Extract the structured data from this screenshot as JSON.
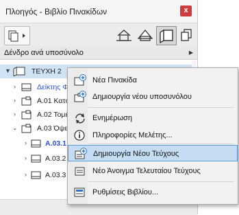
{
  "window": {
    "title": "Πλοηγός - Βιβλίο Πινακίδων",
    "close_label": "x"
  },
  "toolbar": {
    "buttons": [
      {
        "name": "project-map",
        "icon": "house-outline-icon"
      },
      {
        "name": "view-map",
        "icon": "house-plan-icon"
      },
      {
        "name": "layout-book",
        "icon": "layout-book-icon",
        "active": true
      },
      {
        "name": "publisher",
        "icon": "stacked-sheets-icon"
      }
    ]
  },
  "view_dropdown": {
    "value": "Δένδρο ανά υποσύνολο"
  },
  "tree": {
    "rows": [
      {
        "label": "ΤΕΥΧΗ 2",
        "level": 0,
        "expanded": true,
        "selected": true
      },
      {
        "label": "Δείκτης Φ",
        "level": 1,
        "expanded": false,
        "style": "blue"
      },
      {
        "label": "Α.01 Κατό",
        "level": 1,
        "expanded": false
      },
      {
        "label": "Α.02 Τομέ",
        "level": 1,
        "expanded": false
      },
      {
        "label": "Α.03 Όψε",
        "level": 1,
        "expanded": true
      },
      {
        "label": "Α.03.1 Ο",
        "level": 2,
        "expanded": false,
        "style": "blue-bold"
      },
      {
        "label": "Α.03.2 Ο",
        "level": 2,
        "expanded": false
      },
      {
        "label": "Α.03.3 Ο",
        "level": 2,
        "expanded": false
      }
    ]
  },
  "context_menu": {
    "items": [
      {
        "label": "Νέα Πινακίδα",
        "icon": "new-layout-icon"
      },
      {
        "label": "Δημιουργία νέου υποσυνόλου",
        "icon": "new-subset-icon"
      },
      {
        "label": "Ενημέρωση",
        "icon": "refresh-icon"
      },
      {
        "label": "Πληροφορίες Μελέτης...",
        "icon": "info-icon"
      },
      {
        "label": "Δημιουργία Νέου Τεύχους",
        "icon": "new-issue-icon",
        "highlighted": true
      },
      {
        "label": "Νέο Άνοιγμα Τελευταίου Τεύχους",
        "icon": "reopen-issue-icon"
      },
      {
        "label": "Ρυθμίσεις Βιβλίου...",
        "icon": "book-settings-icon"
      }
    ]
  },
  "colors": {
    "accent": "#2b6fc0",
    "selection": "#cfe3f5",
    "highlight": "#c5dcf2",
    "close": "#cf3a3a"
  }
}
